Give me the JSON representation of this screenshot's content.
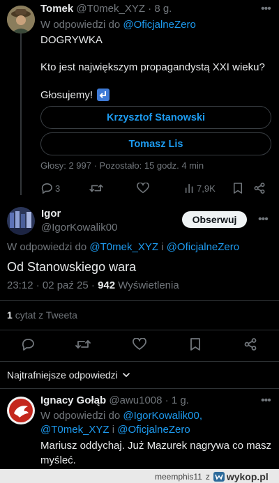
{
  "tweet1": {
    "author_name": "Tomek",
    "handle": "@T0mek_XYZ",
    "time": "· 8 g.",
    "reply_prefix": "W odpowiedzi do",
    "reply_to": "@OficjalneZero",
    "line1": "DOGRYWKA",
    "line2": "Kto jest największym propagandystą XXI wieku?",
    "line3": "Głosujemy!",
    "poll_options": [
      "Krzysztof Stanowski",
      "Tomasz Lis"
    ],
    "poll_footer": "Głosy: 2 997 · Pozostało: 15 godz. 4 min",
    "replies": "3",
    "views": "7,9K"
  },
  "tweet2": {
    "author_name": "Igor",
    "handle": "@IgorKowalik00",
    "follow_label": "Obserwuj",
    "reply_prefix": "W odpowiedzi do",
    "reply_to_1": "@T0mek_XYZ",
    "reply_and": "i",
    "reply_to_2": "@OficjalneZero",
    "text": "Od Stanowskiego wara",
    "timestamp": "23:12 · 02 paź 25 ·",
    "views_count": "942",
    "views_label": "Wyświetlenia",
    "quote_count": "1",
    "quote_label": "cytat z Tweeta"
  },
  "sort": {
    "label": "Najtrafniejsze odpowiedzi"
  },
  "tweet3": {
    "author_name": "Ignacy Gołąb",
    "handle": "@awu1008",
    "time": "· 1 g.",
    "reply_prefix": "W odpowiedzi do",
    "reply_to_1": "@IgorKowalik00,",
    "reply_to_2": "@T0mek_XYZ",
    "reply_and": "i",
    "reply_to_3": "@OficjalneZero",
    "text_line1": "Mariusz oddychaj. Już Mazurek nagrywa co masz",
    "text_line2": "myśleć."
  },
  "footer": {
    "user": "meemphis11",
    "z": "z",
    "site": "wykop.pl"
  },
  "colors": {
    "background": "#000000",
    "link": "#1d9bf0",
    "muted": "#71767b",
    "text": "#e7e9ea"
  }
}
